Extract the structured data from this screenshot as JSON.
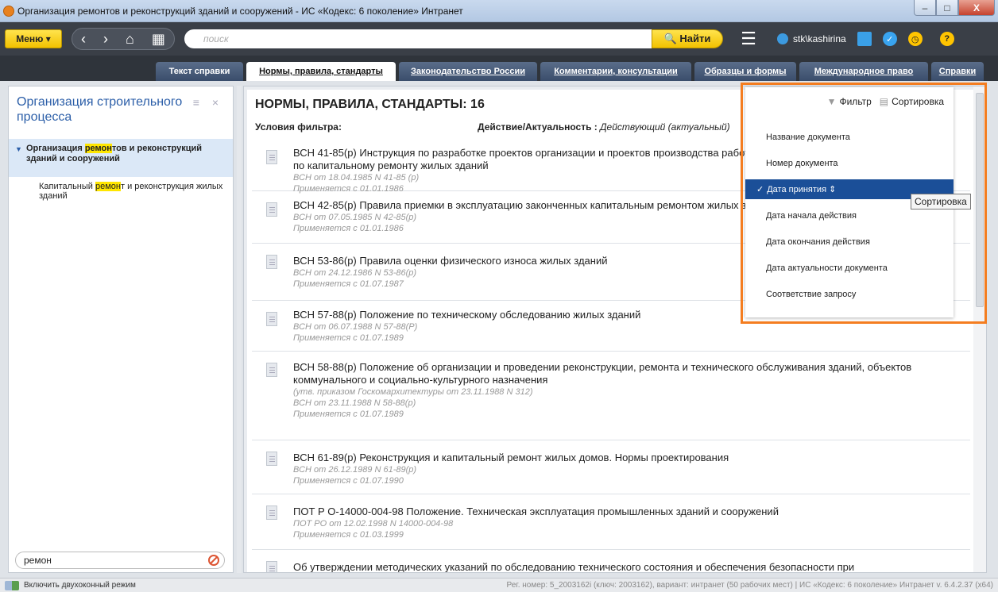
{
  "window": {
    "title": "Организация ремонтов и реконструкций зданий и сооружений - ИС «Кодекс: 6 поколение» Интранет",
    "btn_minimize": "–",
    "btn_maximize": "□",
    "btn_close": "X"
  },
  "toolbar": {
    "menu_label": "Меню ▾",
    "back": "‹",
    "forward": "›",
    "home": "⌂",
    "grid": "▦",
    "search_placeholder": "поиск",
    "find_label": "🔍 Найти",
    "hamburger": "☰",
    "user": "stk\\kashirina",
    "help": "?"
  },
  "tabs": [
    {
      "label": "Текст справки"
    },
    {
      "label": "Нормы, правила, стандарты"
    },
    {
      "label": "Законодательство России"
    },
    {
      "label": "Комментарии, консультации"
    },
    {
      "label": "Образцы и формы"
    },
    {
      "label": "Международное право"
    },
    {
      "label": "Справки"
    }
  ],
  "left_panel": {
    "title": "Организация строительного процесса",
    "controls": "≡ ×",
    "item_main_pre": "Организация ",
    "item_main_hl": "ремон",
    "item_main_post": "тов и реконструкций зданий и сооружений",
    "item_sub_pre": "Капитальный ",
    "item_sub_hl": "ремон",
    "item_sub_post": "т и реконструкция жилых зданий",
    "search_value": "ремон"
  },
  "main": {
    "heading": "НОРМЫ, ПРАВИЛА, СТАНДАРТЫ: 16",
    "filter_label": "Условия фильтра:",
    "action_label": "Действие/Актуальность : ",
    "action_value": "Действующий (актуальный)",
    "documents": [
      {
        "title": "ВСН 41-85(р) Инструкция по разработке проектов организации и проектов производства работ по капитальному ремонту жилых зданий",
        "meta1": "ВСН от 18.04.1985 N 41-85 (р)",
        "meta2": "Применяется с 01.01.1986",
        "meta3": ""
      },
      {
        "title": "ВСН 42-85(р) Правила приемки в эксплуатацию законченных капитальным ремонтом жилых зданий",
        "meta1": "ВСН от 07.05.1985 N 42-85(р)",
        "meta2": "Применяется с 01.01.1986",
        "meta3": ""
      },
      {
        "title": "ВСН 53-86(р) Правила оценки физического износа жилых зданий",
        "meta1": "ВСН от 24.12.1986 N 53-86(р)",
        "meta2": "Применяется с 01.07.1987",
        "meta3": ""
      },
      {
        "title": "ВСН 57-88(р) Положение по техническому обследованию жилых зданий",
        "meta1": "ВСН от 06.07.1988 N 57-88(Р)",
        "meta2": "Применяется с 01.07.1989",
        "meta3": ""
      },
      {
        "title": "ВСН 58-88(р) Положение об организации и проведении реконструкции, ремонта и технического обслуживания зданий, объектов коммунального и социально-культурного назначения",
        "meta1": "(утв. приказом Госкомархитектуры от 23.11.1988 N 312)",
        "meta2": "ВСН от 23.11.1988 N 58-88(р)",
        "meta3": "Применяется с 01.07.1989"
      },
      {
        "title": "ВСН 61-89(р) Реконструкция и капитальный ремонт жилых домов. Нормы проектирования",
        "meta1": "ВСН от 26.12.1989 N 61-89(р)",
        "meta2": "Применяется с 01.07.1990",
        "meta3": ""
      },
      {
        "title": "ПОТ Р О-14000-004-98 Положение. Техническая эксплуатация промышленных зданий и сооружений",
        "meta1": "ПОТ РО от 12.02.1998 N 14000-004-98",
        "meta2": "Применяется с 01.03.1999",
        "meta3": ""
      },
      {
        "title": "Об утверждении методических указаний по обследованию технического состояния и обеспечения безопасности при",
        "meta1": "",
        "meta2": "",
        "meta3": ""
      }
    ]
  },
  "sort_menu": {
    "filter_label": "Фильтр",
    "sort_label": "Сортировка",
    "items": [
      {
        "label": "Название документа"
      },
      {
        "label": "Номер документа"
      },
      {
        "label": "Дата принятия ⇕"
      },
      {
        "label": "Дата начала действия"
      },
      {
        "label": "Дата окончания действия"
      },
      {
        "label": "Дата актуальности документа"
      },
      {
        "label": "Соответствие запросу"
      }
    ],
    "tooltip": "Сортировка"
  },
  "statusbar": {
    "mode_label": "Включить двухоконный режим",
    "info": "Рег. номер: 5_2003162i (ключ: 2003162), вариант: интранет (50 рабочих мест)  |  ИС «Кодекс: 6 поколение» Интранет v. 6.4.2.37 (x64)"
  }
}
